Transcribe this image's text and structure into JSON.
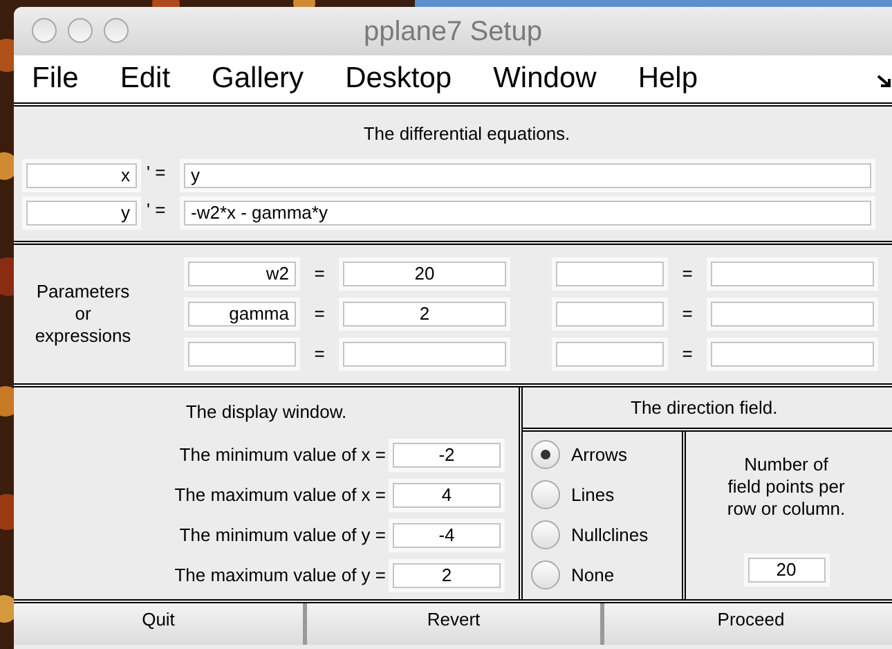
{
  "window": {
    "title": "pplane7 Setup"
  },
  "menu": [
    "File",
    "Edit",
    "Gallery",
    "Desktop",
    "Window",
    "Help"
  ],
  "equations": {
    "title": "The differential equations.",
    "rows": [
      {
        "variable": "x",
        "prime": "' =",
        "expression": "y"
      },
      {
        "variable": "y",
        "prime": "' =",
        "expression": "-w2*x - gamma*y"
      }
    ]
  },
  "parameters": {
    "label": "Parameters\nor\nexpressions",
    "pairs": [
      {
        "name": "w2",
        "equals": "=",
        "value": "20"
      },
      {
        "equals": "="
      },
      {
        "name": "gamma",
        "equals": "=",
        "value": "2"
      },
      {
        "equals": "="
      },
      {
        "equals": "="
      },
      {
        "equals": "="
      }
    ]
  },
  "display_window": {
    "title": "The display window.",
    "rows": [
      {
        "label": "The minimum value of x =",
        "value": "-2"
      },
      {
        "label": "The maximum value of x =",
        "value": "4"
      },
      {
        "label": "The minimum value of y =",
        "value": "-4"
      },
      {
        "label": "The maximum value of y =",
        "value": "2"
      }
    ]
  },
  "direction_field": {
    "title": "The direction field.",
    "options": [
      {
        "label": "Arrows",
        "selected": true
      },
      {
        "label": "Lines",
        "selected": false
      },
      {
        "label": "Nullclines",
        "selected": false
      },
      {
        "label": "None",
        "selected": false
      }
    ],
    "points": {
      "label": "Number of\nfield points per\nrow or column.",
      "value": "20"
    }
  },
  "buttons": [
    "Quit",
    "Revert",
    "Proceed"
  ]
}
